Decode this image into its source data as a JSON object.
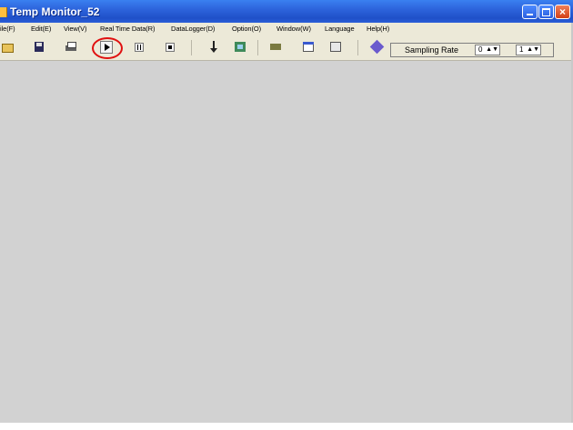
{
  "window": {
    "title": "Temp Monitor_52"
  },
  "menubar": {
    "items": [
      "ile(F)",
      "Edit(E)",
      "View(V)",
      "Real Time Data(R)",
      "DataLogger(D)",
      "Option(O)",
      "Window(W)",
      "Language",
      "Help(H)"
    ]
  },
  "toolbar": {
    "icons": [
      "open-icon",
      "save-icon",
      "print-icon",
      "play-icon",
      "pause-icon",
      "stop-icon",
      "download-icon",
      "chart-icon",
      "memory-icon",
      "table-icon",
      "report-icon",
      "book-icon"
    ],
    "highlight_color": "#e01010"
  },
  "sampling": {
    "label": "Sampling Rate",
    "value1": "0",
    "value2": "1"
  },
  "colors": {
    "titlebar": "#2d64dc",
    "client_background": "#d2d2d2",
    "menubar_background": "#ece9d8"
  }
}
